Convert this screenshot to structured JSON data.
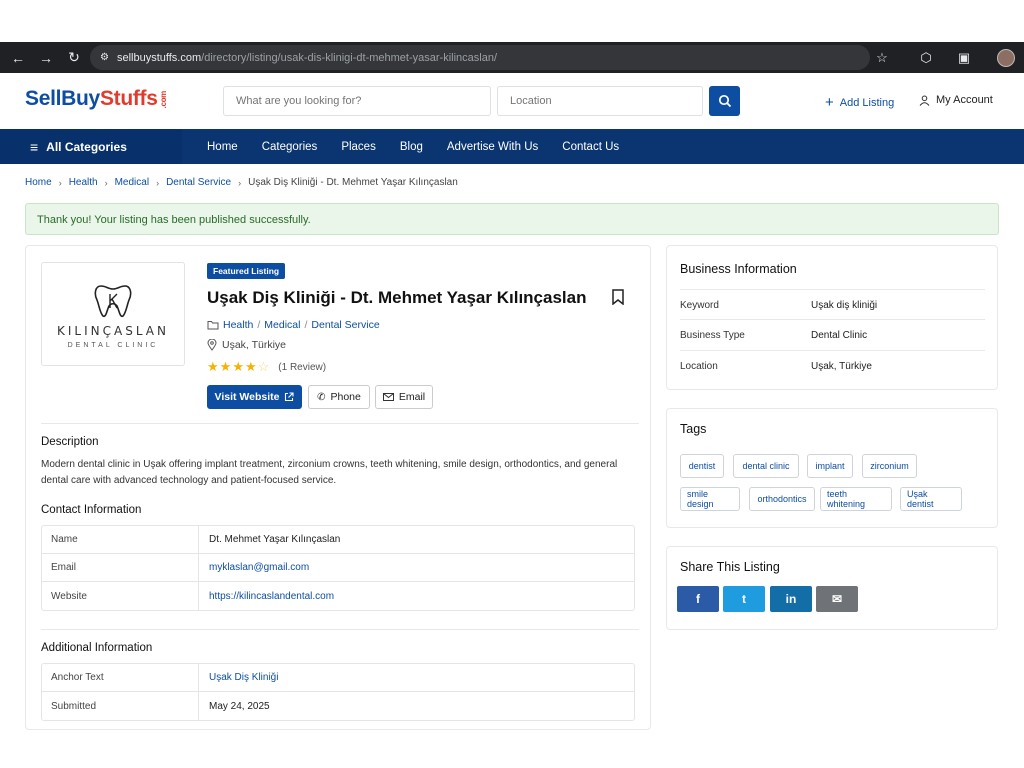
{
  "browser": {
    "url_host": "sellbuystuffs.com",
    "url_path": "/directory/listing/usak-dis-klinigi-dt-mehmet-yasar-kilincaslan/"
  },
  "header": {
    "logo_a": "SellBuy",
    "logo_b": "Stuffs",
    "logo_com": ".com",
    "search_placeholder": "What are you looking for?",
    "location_placeholder": "Location",
    "add_listing": "Add Listing",
    "my_account": "My Account"
  },
  "nav": {
    "all_categories": "All Categories",
    "links": [
      "Home",
      "Categories",
      "Places",
      "Blog",
      "Advertise With Us",
      "Contact Us"
    ]
  },
  "breadcrumb": [
    "Home",
    "Health",
    "Medical",
    "Dental Service",
    "Uşak Diş Kliniği - Dt. Mehmet Yaşar Kılınçaslan"
  ],
  "alert": "Thank you! Your listing has been published successfully.",
  "listing": {
    "logo_brand": "KILINÇASLAN",
    "logo_sub": "DENTAL CLINIC",
    "featured": "Featured Listing",
    "title": "Uşak Diş Kliniği - Dt. Mehmet Yaşar Kılınçaslan",
    "categories": [
      "Health",
      "Medical",
      "Dental Service"
    ],
    "location": "Uşak, Türkiye",
    "rating": 4,
    "rating_max": 5,
    "reviews": "(1 Review)",
    "visit_website": "Visit Website",
    "phone": "Phone",
    "email": "Email"
  },
  "description": {
    "heading": "Description",
    "text": "Modern dental clinic in Uşak offering implant treatment, zirconium crowns, teeth whitening, smile design, orthodontics, and general dental care with advanced technology and patient-focused service."
  },
  "contact": {
    "heading": "Contact Information",
    "rows": [
      {
        "k": "Name",
        "v": "Dt. Mehmet Yaşar Kılınçaslan"
      },
      {
        "k": "Email",
        "v": "myklaslan@gmail.com"
      },
      {
        "k": "Website",
        "v": "https://kilincaslandental.com"
      }
    ]
  },
  "additional": {
    "heading": "Additional Information",
    "rows": [
      {
        "k": "Anchor Text",
        "v": "Uşak Diş Kliniği"
      },
      {
        "k": "Submitted",
        "v": "May 24, 2025"
      }
    ]
  },
  "business": {
    "title": "Business Information",
    "rows": [
      {
        "k": "Keyword",
        "v": "Uşak diş kliniği"
      },
      {
        "k": "Business Type",
        "v": "Dental Clinic"
      },
      {
        "k": "Location",
        "v": "Uşak, Türkiye"
      }
    ]
  },
  "tags": {
    "title": "Tags",
    "items": [
      "dentist",
      "dental clinic",
      "implant",
      "zirconium",
      "smile design",
      "orthodontics",
      "teeth whitening",
      "Uşak dentist"
    ]
  },
  "share": {
    "title": "Share This Listing",
    "buttons": [
      {
        "label": "f",
        "color": "#2b5aa6"
      },
      {
        "label": "t",
        "color": "#1f9be0"
      },
      {
        "label": "in",
        "color": "#136ea8"
      },
      {
        "label": "✉",
        "color": "#6f7378"
      }
    ]
  },
  "colors": {
    "brand": "#0d4ea3",
    "navbar": "#0a3570",
    "accent_red": "#e23b2e",
    "star": "#f5b301"
  }
}
